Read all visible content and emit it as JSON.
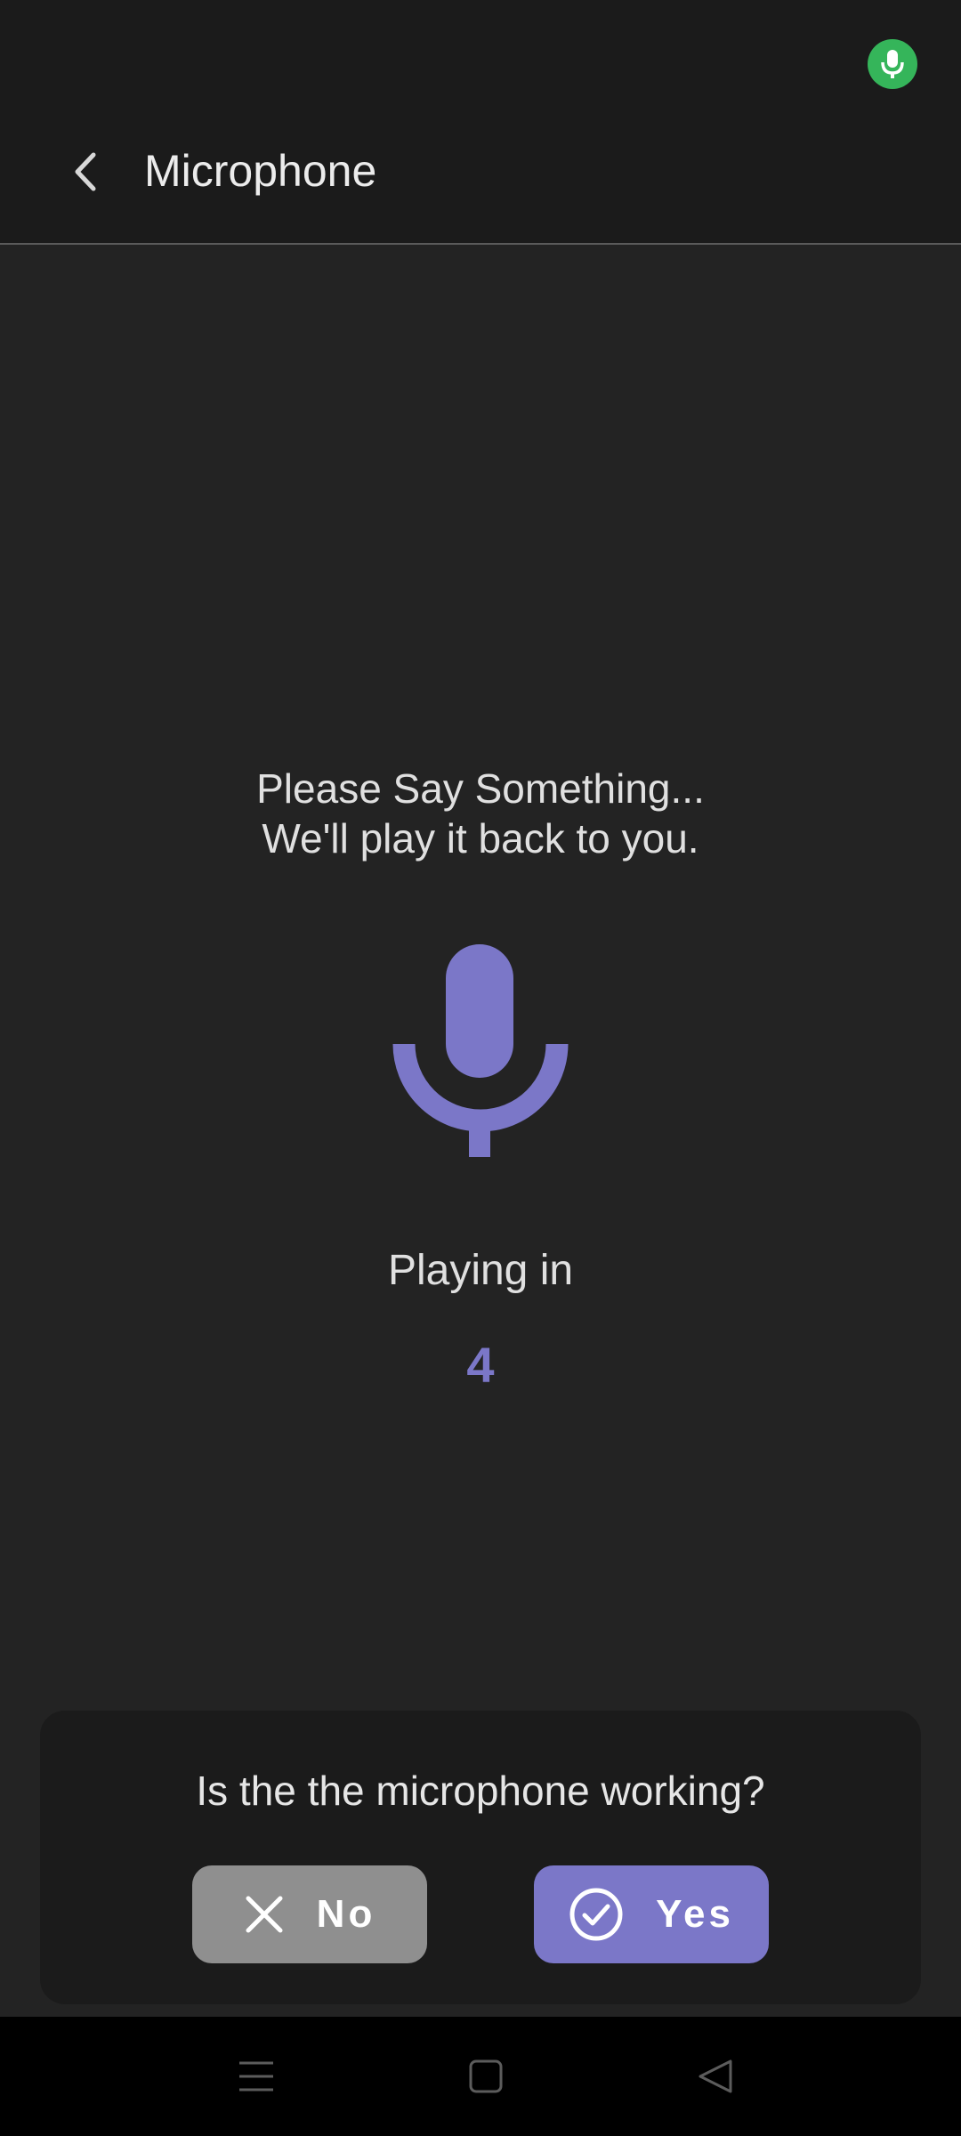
{
  "status_bar": {
    "indicator_icon": "microphone-in-use-icon",
    "indicator_color": "#35b55a"
  },
  "app_bar": {
    "back_icon": "chevron-left-icon",
    "title": "Microphone"
  },
  "main": {
    "prompt_line1": "Please Say Something...",
    "prompt_line2": "We'll play it back to you.",
    "mic_icon": "microphone-icon",
    "playing_label": "Playing in",
    "countdown": "4",
    "accent_color": "#7b77c8"
  },
  "dialog": {
    "question": "Is the the microphone working?",
    "no_button": {
      "label": "No",
      "icon": "close-icon",
      "color": "#8f8f8f"
    },
    "yes_button": {
      "label": "Yes",
      "icon": "check-circle-icon",
      "color": "#7b77c8"
    }
  },
  "nav_bar": {
    "menu_icon": "recent-apps-icon",
    "home_icon": "home-icon",
    "back_icon": "back-triangle-icon"
  }
}
